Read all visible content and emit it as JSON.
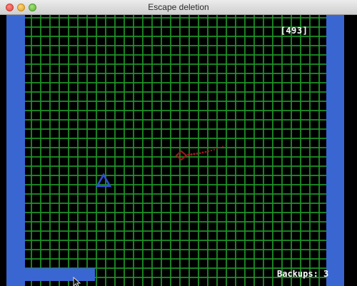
{
  "window": {
    "title": "Escape deletion"
  },
  "hud": {
    "timer": "[493]",
    "backups_label": "Backups:",
    "backups_count": "3"
  },
  "colors": {
    "grid": "#1e9628",
    "walls": "#3a66d2",
    "player": "#2f4fd0",
    "enemy": "#a0181c",
    "background": "#000000",
    "hud_text": "#ffffff"
  },
  "icons": {
    "player": "triangle-ship-icon",
    "enemy": "diamond-chaser-icon",
    "cursor": "mouse-pointer-icon"
  }
}
